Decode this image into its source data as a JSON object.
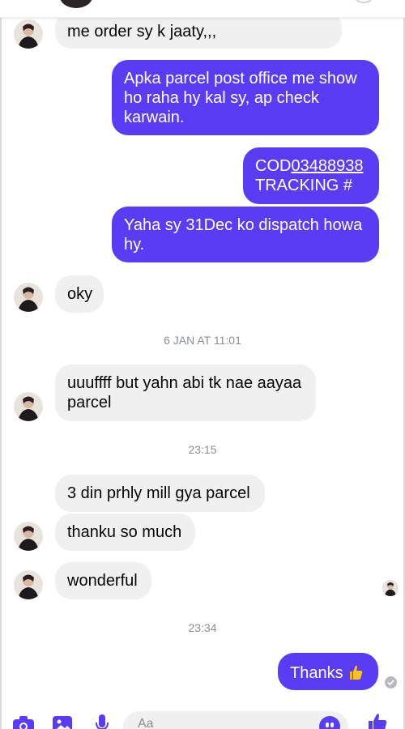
{
  "colors": {
    "outgoing": "#5b3cf5",
    "incoming": "#f0f0f0",
    "timestamp": "#8a8d91"
  },
  "messages": {
    "m1": {
      "lines": [
        "me order sy k jaaty,,,"
      ]
    },
    "m2": {
      "lines": [
        "Apka parcel post office me show",
        "ho raha hy kal sy, ap check",
        "karwain."
      ]
    },
    "m3": {
      "prefix": "COD",
      "tracking_number": "03488938",
      "line2": "TRACKING #"
    },
    "m4": {
      "lines": [
        "Yaha sy 31Dec ko dispatch howa",
        "hy."
      ]
    },
    "m5": {
      "lines": [
        "oky"
      ]
    },
    "m6": {
      "lines": [
        "uuuffff but yahn abi tk nae aayaa",
        "parcel"
      ]
    },
    "m7": {
      "lines": [
        "3 din prhly mill gya parcel"
      ]
    },
    "m8": {
      "lines": [
        "thanku so much"
      ]
    },
    "m9": {
      "lines": [
        "wonderful"
      ]
    },
    "m10": {
      "text": "Thanks",
      "emoji": "thumbs-up-emoji"
    }
  },
  "timestamps": [
    "6 JAN AT 11:01",
    "23:15",
    "23:34"
  ],
  "composer": {
    "placeholder": "Aa",
    "icons": [
      "camera-icon",
      "gallery-icon",
      "microphone-icon",
      "emoji-icon",
      "like-icon"
    ]
  }
}
